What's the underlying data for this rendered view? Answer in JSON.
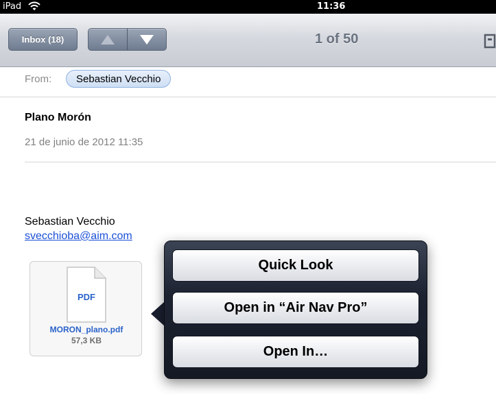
{
  "status_bar": {
    "carrier": "iPad",
    "time": "11:36"
  },
  "toolbar": {
    "inbox_label": "Inbox (18)",
    "message_position": "1 of 50"
  },
  "message": {
    "from_label": "From:",
    "from_name": "Sebastian Vecchio",
    "subject": "Plano Morón",
    "date": "21 de junio de 2012 11:35",
    "body_name": "Sebastian Vecchio",
    "body_email": "svecchioba@aim.com"
  },
  "attachment": {
    "type_label": "PDF",
    "file_name": "MORON_plano.pdf",
    "file_size": "57,3 KB"
  },
  "popover": {
    "items": [
      {
        "label": "Quick Look"
      },
      {
        "label": "Open in “Air Nav Pro”"
      },
      {
        "label": "Open In…"
      }
    ]
  }
}
